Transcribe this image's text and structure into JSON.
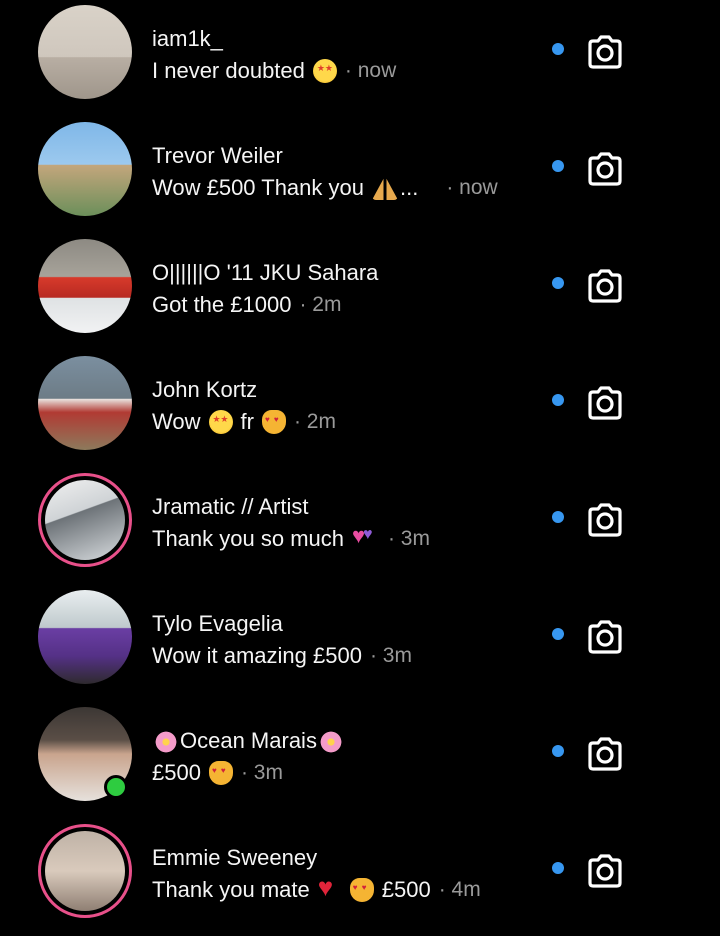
{
  "colors": {
    "background": "#000000",
    "text": "#f5f5f5",
    "time": "#9a9a9a",
    "unread_dot": "#3797f0",
    "story_ring": "#e8508a",
    "online": "#2ecc40"
  },
  "threads": [
    {
      "name": "iam1k_",
      "message": "I never doubted",
      "emoji": [
        "star-struck-face"
      ],
      "time": "· now",
      "avatar_style": "a0",
      "story": false,
      "online": false,
      "unread": true
    },
    {
      "name": "Trevor Weiler",
      "message": "Wow £500 Thank you",
      "emoji": [
        "folded-hands"
      ],
      "ellipsis": "...",
      "time": "· now",
      "avatar_style": "a1",
      "story": false,
      "online": false,
      "unread": true
    },
    {
      "name": "O||||||O  '11 JKU Sahara",
      "message": "Got the £1000",
      "emoji": [],
      "time": "· 2m",
      "avatar_style": "a2",
      "story": false,
      "online": false,
      "unread": true
    },
    {
      "name": "John Kortz",
      "message": "Wow",
      "emoji": [
        "star-struck-face"
      ],
      "message2": "fr",
      "emoji2": [
        "heart-eyes-cat"
      ],
      "time": "· 2m",
      "avatar_style": "a3",
      "story": false,
      "online": false,
      "unread": true
    },
    {
      "name": "Jramatic // Artist",
      "message": "Thank you so much",
      "emoji": [
        "heart-arrow"
      ],
      "time": "· 3m",
      "avatar_style": "a4",
      "story": true,
      "online": false,
      "unread": true
    },
    {
      "name": "Tylo Evagelia",
      "message": "Wow it amazing £500",
      "emoji": [],
      "time": "· 3m",
      "avatar_style": "a5",
      "story": false,
      "online": false,
      "unread": true
    },
    {
      "name": "Ocean Marais",
      "name_emoji": "cherry-blossom",
      "message": "£500",
      "emoji": [
        "heart-eyes-cat"
      ],
      "time": "· 3m",
      "avatar_style": "a6",
      "story": false,
      "online": true,
      "unread": true
    },
    {
      "name": "Emmie Sweeney",
      "message": "Thank you mate",
      "emoji": [
        "red-heart",
        "heart-eyes-cat"
      ],
      "message2": "£500",
      "time": "· 4m",
      "avatar_style": "a7",
      "story": true,
      "online": false,
      "unread": true
    }
  ],
  "icons": {
    "camera": "camera-icon",
    "unread": "unread-dot"
  }
}
